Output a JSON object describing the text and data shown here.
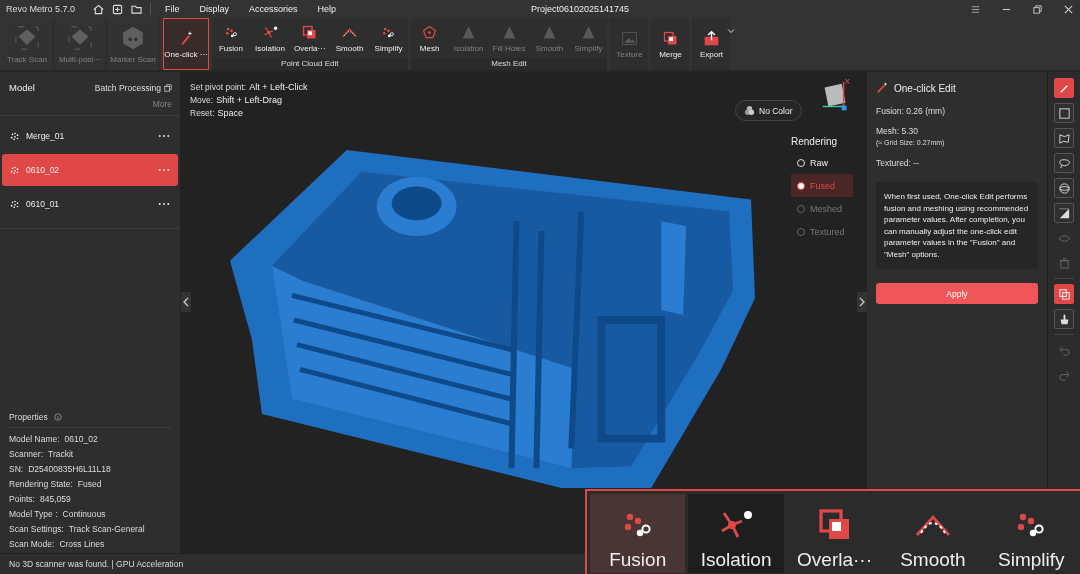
{
  "app": {
    "title": "Revo Metro 5.7.0",
    "project": "Project06102025141745"
  },
  "menu": [
    "File",
    "Display",
    "Accessories",
    "Help"
  ],
  "ribbon": [
    {
      "buttons": [
        {
          "label": "Track Scan",
          "kind": "track",
          "disabled": true,
          "selected": false
        },
        {
          "label": "Multi-posi···",
          "kind": "multi",
          "disabled": true,
          "selected": false
        },
        {
          "label": "Marker Scan",
          "kind": "marker",
          "disabled": true,
          "selected": false
        }
      ]
    },
    {
      "buttons": [
        {
          "label": "One-click ···",
          "kind": "wand",
          "disabled": false,
          "selected": true
        }
      ]
    },
    {
      "label": "Point Cloud Edit",
      "buttons": [
        {
          "label": "Fusion",
          "kind": "fusion",
          "disabled": false,
          "selected": false
        },
        {
          "label": "Isolation",
          "kind": "isolation",
          "disabled": false,
          "selected": false
        },
        {
          "label": "Overla···",
          "kind": "overlap",
          "disabled": false,
          "selected": false
        },
        {
          "label": "Smooth",
          "kind": "smooth",
          "disabled": false,
          "selected": false
        },
        {
          "label": "Simplify",
          "kind": "simplify",
          "disabled": false,
          "selected": false
        }
      ]
    },
    {
      "label": "Mesh Edit",
      "buttons": [
        {
          "label": "Mesh",
          "kind": "mesh",
          "disabled": false,
          "selected": false
        },
        {
          "label": "Isolation",
          "kind": "triangle",
          "disabled": true,
          "selected": false
        },
        {
          "label": "Fill Holes",
          "kind": "fillholes",
          "disabled": true,
          "selected": false
        },
        {
          "label": "Smooth",
          "kind": "triangle",
          "disabled": true,
          "selected": false
        },
        {
          "label": "Simplify",
          "kind": "triangle",
          "disabled": true,
          "selected": false
        }
      ]
    },
    {
      "buttons": [
        {
          "label": "Texture",
          "kind": "texture",
          "disabled": true,
          "selected": false
        }
      ]
    },
    {
      "buttons": [
        {
          "label": "Merge",
          "kind": "merge",
          "disabled": false,
          "selected": false
        }
      ]
    },
    {
      "buttons": [
        {
          "label": "Export",
          "kind": "export",
          "disabled": false,
          "selected": false
        }
      ]
    }
  ],
  "model_panel": {
    "title": "Model",
    "batch": "Batch Processing",
    "more": "More",
    "items": [
      {
        "name": "Merge_01",
        "selected": false
      },
      {
        "name": "0610_02",
        "selected": true
      },
      {
        "name": "0610_01",
        "selected": false
      }
    ]
  },
  "properties": {
    "title": "Properties",
    "rows": [
      {
        "label": "Model Name:",
        "value": "0610_02"
      },
      {
        "label": "Scanner:",
        "value": "Trackit"
      },
      {
        "label": "SN:",
        "value": "D25400835H6L11L18"
      },
      {
        "label": "Rendering State:",
        "value": "Fused"
      },
      {
        "label": "Points:",
        "value": "845,059"
      },
      {
        "label": "Model Type :",
        "value": "Continuous"
      },
      {
        "label": "Scan Settings:",
        "value": "Track Scan-General"
      },
      {
        "label": "Scan Mode:",
        "value": "Cross Lines"
      }
    ]
  },
  "viewport": {
    "hints": [
      {
        "label": "Set pivot point:",
        "value": "Alt + Left-Click"
      },
      {
        "label": "Move:",
        "value": "Shift + Left-Drag"
      },
      {
        "label": "Reset:",
        "value": "Space"
      }
    ],
    "color_button": "No Color",
    "rendering": {
      "title": "Rendering",
      "options": [
        {
          "label": "Raw",
          "selected": false,
          "disabled": false
        },
        {
          "label": "Fused",
          "selected": true,
          "disabled": false
        },
        {
          "label": "Meshed",
          "selected": false,
          "disabled": true
        },
        {
          "label": "Textured",
          "selected": false,
          "disabled": true
        }
      ]
    }
  },
  "edit_panel": {
    "title": "One-click Edit",
    "fusion": "Fusion:  0.26 (mm)",
    "mesh": "Mesh:  5.30",
    "grid": "(≈ Grid Size: 0.27mm)",
    "textured": "Textured: --",
    "note": "When first used, One-click Edit performs fusion and meshing using recommended parameter values. After completion, you can manually adjust the one-click edit parameter values in the \"Fusion\" and \"Mesh\" options.",
    "apply": "Apply"
  },
  "tools": [
    {
      "kind": "wand",
      "active": true,
      "disabled": false
    },
    {
      "kind": "rect",
      "active": false,
      "disabled": false
    },
    {
      "kind": "polygon",
      "active": false,
      "disabled": false
    },
    {
      "kind": "lasso",
      "active": false,
      "disabled": false
    },
    {
      "kind": "sphere",
      "active": false,
      "disabled": false
    },
    {
      "kind": "invert",
      "active": false,
      "disabled": false
    },
    {
      "kind": "hide",
      "active": false,
      "disabled": true
    },
    {
      "kind": "trash",
      "active": false,
      "disabled": true
    },
    {
      "kind": "overlap",
      "active": true,
      "disabled": false
    },
    {
      "kind": "brush",
      "active": false,
      "disabled": false
    },
    {
      "kind": "undo",
      "active": false,
      "disabled": true
    },
    {
      "kind": "redo",
      "active": false,
      "disabled": true
    }
  ],
  "status": "No 3D scanner was found.  | GPU Acceleration",
  "inset": [
    {
      "label": "Fusion",
      "kind": "fusion",
      "selected": true,
      "hovered": false
    },
    {
      "label": "Isolation",
      "kind": "isolation",
      "selected": false,
      "hovered": true
    },
    {
      "label": "Overla···",
      "kind": "overlap",
      "selected": false,
      "hovered": false
    },
    {
      "label": "Smooth",
      "kind": "smooth",
      "selected": false,
      "hovered": false
    },
    {
      "label": "Simplify",
      "kind": "simplify",
      "selected": false,
      "hovered": false
    }
  ]
}
